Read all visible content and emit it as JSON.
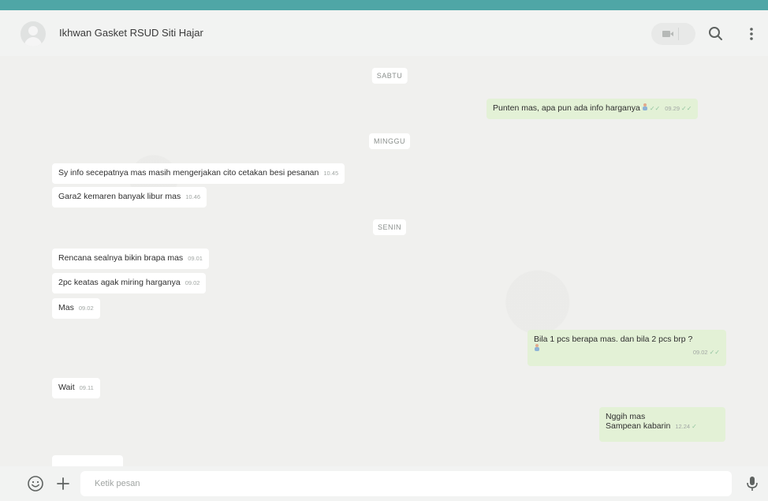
{
  "header": {
    "contact_name": "Ikhwan Gasket RSUD Siti Hajar",
    "icons": [
      "avatar",
      "video-call-icon",
      "search-icon",
      "menu-icon"
    ]
  },
  "chat": {
    "dates": {
      "sabtu": "SABTU",
      "minggu": "MINGGU",
      "senin": "SENIN"
    },
    "messages": [
      {
        "dir": "out",
        "text": "Punten mas, apa pun ada info harganya",
        "time": "09.29"
      },
      {
        "dir": "in",
        "text": "Sy info secepatnya mas masih mengerjakan cito cetakan besi pesanan",
        "time": "10.45"
      },
      {
        "dir": "in",
        "text": "Gara2 kemaren banyak libur mas",
        "time": "10.46"
      },
      {
        "dir": "in",
        "text": "Rencana sealnya bikin brapa mas",
        "time": "09.01"
      },
      {
        "dir": "in",
        "text": "2pc keatas agak miring harganya",
        "time": "09.02"
      },
      {
        "dir": "in",
        "text": "Mas",
        "time": "09.02"
      },
      {
        "dir": "out",
        "text": "Bila 1 pcs berapa mas. dan bila 2 pcs brp ?",
        "time": "09.02"
      },
      {
        "dir": "in",
        "text": "Wait",
        "time": "09.11"
      },
      {
        "dir": "out",
        "line1": "Nggih mas",
        "line2": "Sampean kabarin",
        "time": "12.24"
      }
    ]
  },
  "composer": {
    "placeholder": "Ketik pesan"
  },
  "colors": {
    "accent_strip": "#4fa6a6",
    "incoming_bubble": "#ffffff",
    "outgoing_bubble": "#e3f1d6",
    "chat_background": "#f0f0ee"
  }
}
